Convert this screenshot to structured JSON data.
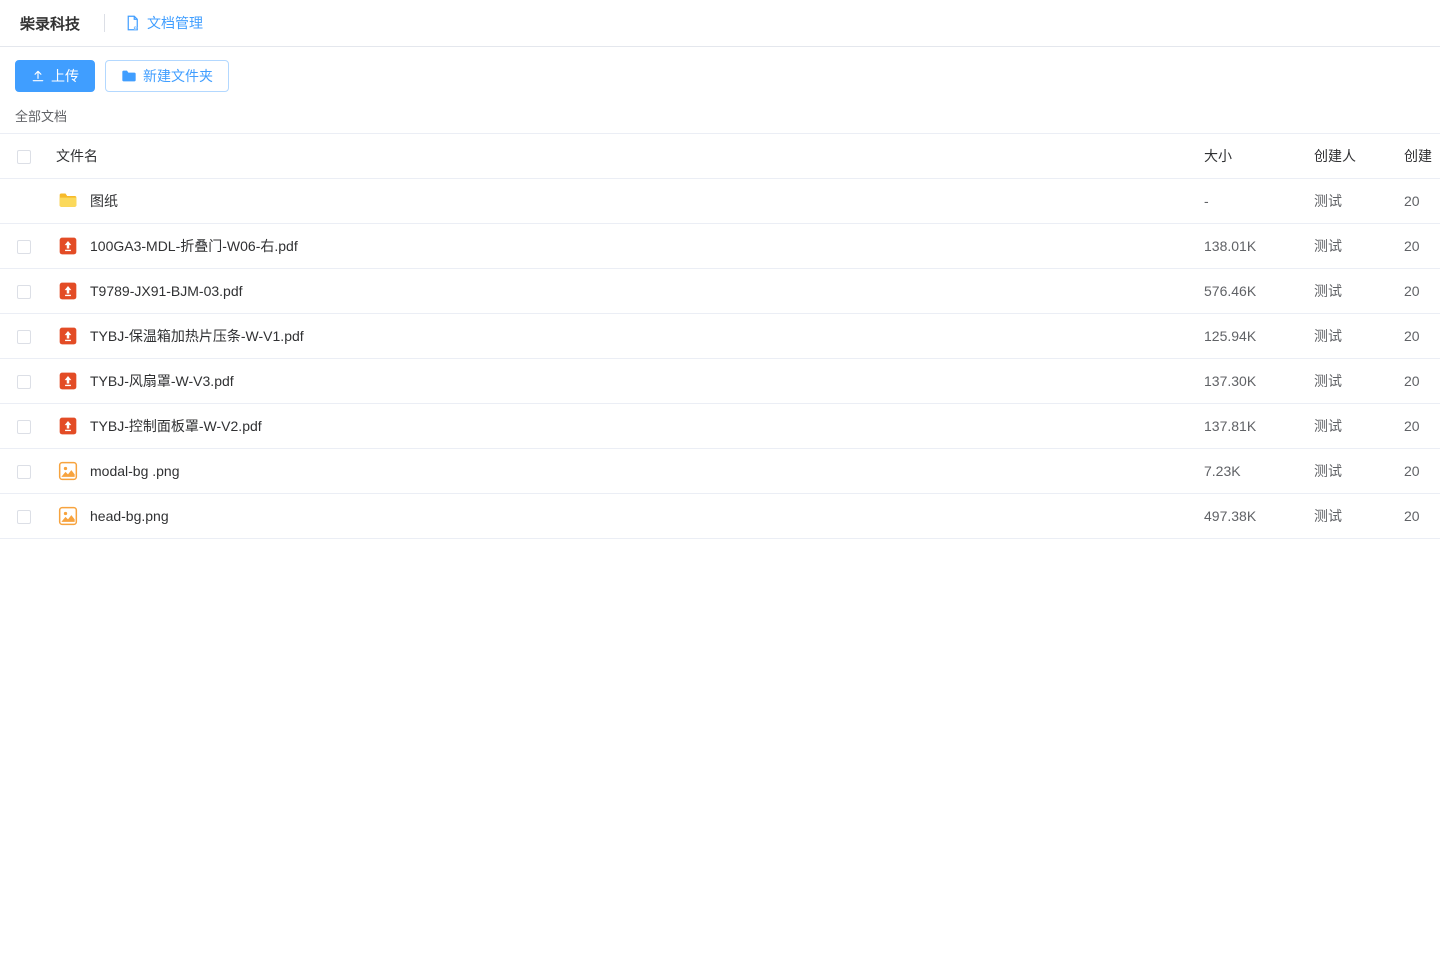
{
  "header": {
    "brand": "柴录科技",
    "doc_mgmt_label": "文档管理"
  },
  "toolbar": {
    "upload_label": "上传",
    "new_folder_label": "新建文件夹"
  },
  "breadcrumb": "全部文档",
  "columns": {
    "name": "文件名",
    "size": "大小",
    "creator": "创建人",
    "time": "创建"
  },
  "rows": [
    {
      "type": "folder",
      "name": "图纸",
      "size": "-",
      "creator": "测试",
      "time": "20"
    },
    {
      "type": "pdf",
      "name": "100GA3-MDL-折叠门-W06-右.pdf",
      "size": "138.01K",
      "creator": "测试",
      "time": "20"
    },
    {
      "type": "pdf",
      "name": "T9789-JX91-BJM-03.pdf",
      "size": "576.46K",
      "creator": "测试",
      "time": "20"
    },
    {
      "type": "pdf",
      "name": "TYBJ-保温箱加热片压条-W-V1.pdf",
      "size": "125.94K",
      "creator": "测试",
      "time": "20"
    },
    {
      "type": "pdf",
      "name": "TYBJ-风扇罩-W-V3.pdf",
      "size": "137.30K",
      "creator": "测试",
      "time": "20"
    },
    {
      "type": "pdf",
      "name": "TYBJ-控制面板罩-W-V2.pdf",
      "size": "137.81K",
      "creator": "测试",
      "time": "20"
    },
    {
      "type": "image",
      "name": "modal-bg .png",
      "size": "7.23K",
      "creator": "测试",
      "time": "20"
    },
    {
      "type": "image",
      "name": "head-bg.png",
      "size": "497.38K",
      "creator": "测试",
      "time": "20"
    }
  ]
}
